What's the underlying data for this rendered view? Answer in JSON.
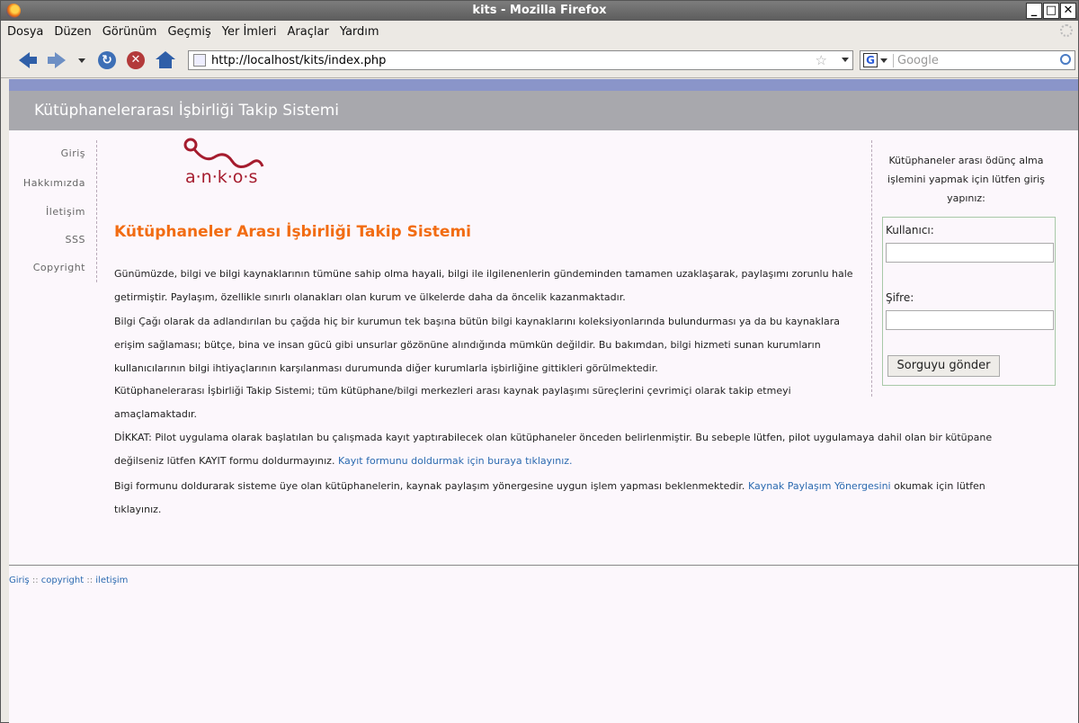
{
  "window": {
    "title": "kits - Mozilla Firefox"
  },
  "menu": [
    "Dosya",
    "Düzen",
    "Görünüm",
    "Geçmiş",
    "Yer İmleri",
    "Araçlar",
    "Yardım"
  ],
  "toolbar": {
    "url": "http://localhost/kits/index.php",
    "search_placeholder": "Google"
  },
  "site": {
    "header_title": "Kütüphanelerarası İşbirliği Takip Sistemi"
  },
  "leftnav": [
    "Giriş",
    "Hakkımızda",
    "İletişim",
    "SSS",
    "Copyright"
  ],
  "logo": {
    "text": "a·n·k·o·s"
  },
  "main": {
    "heading": "Kütüphaneler Arası İşbirliği Takip Sistemi",
    "p1": "Günümüzde, bilgi ve bilgi kaynaklarının tümüne sahip olma hayali, bilgi ile ilgilenenlerin gündeminden tamamen uzaklaşarak, paylaşımı zorunlu hale getirmiştir. Paylaşım, özellikle sınırlı olanakları olan kurum ve ülkelerde daha da öncelik kazanmaktadır.",
    "p2": "Bilgi Çağı olarak da adlandırılan bu çağda hiç bir kurumun tek başına bütün bilgi kaynaklarını koleksiyonlarında bulundurması ya da bu kaynaklara erişim sağlaması; bütçe, bina ve insan gücü gibi unsurlar gözönüne alındığında mümkün değildir. Bu bakımdan, bilgi hizmeti sunan kurumların kullanıcılarının bilgi ihtiyaçlarının karşılanması durumunda diğer kurumlarla işbirliğine gittikleri görülmektedir.",
    "p3": "Kütüphanelerarası İşbirliği Takip Sistemi; tüm kütüphane/bilgi merkezleri arası kaynak paylaşımı süreçlerini çevrimiçi olarak takip etmeyi amaçlamaktadır.",
    "p4_text": "DİKKAT: Pilot uygulama olarak başlatılan bu çalışmada kayıt yaptırabilecek olan kütüphaneler önceden belirlenmiştir. Bu sebeple lütfen, pilot uygulamaya dahil olan bir kütüpane değilseniz lütfen KAYIT formu doldurmayınız.",
    "p4_link": "Kayıt formunu doldurmak için buraya tıklayınız.",
    "p5_text_before": "Bigi formunu doldurarak sisteme üye olan kütüphanelerin, kaynak paylaşım yönergesine uygun işlem yapması beklenmektedir.",
    "p5_link": "Kaynak Paylaşım Yönergesini",
    "p5_text_after": "okumak için lütfen tıklayınız."
  },
  "login": {
    "message": "Kütüphaneler arası ödünç alma işlemini yapmak için lütfen giriş yapınız:",
    "user_label": "Kullanıcı:",
    "user_value": "",
    "pass_label": "Şifre:",
    "pass_value": "",
    "submit": "Sorguyu gönder"
  },
  "footer": {
    "links": [
      "Giriş",
      "copyright",
      "iletişim"
    ],
    "separator": "::"
  }
}
